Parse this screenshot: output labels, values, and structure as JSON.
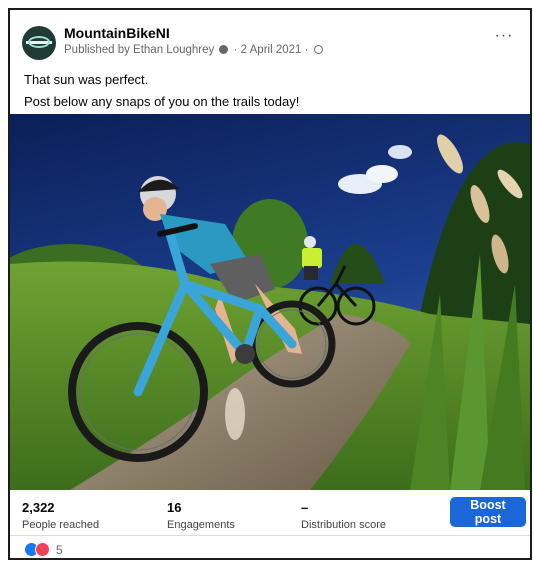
{
  "post": {
    "page_name": "MountainBikeNI",
    "published_by": "Published by Ethan Loughrey",
    "date": "· 2 April 2021 ·",
    "more_label": "···",
    "caption_line1": "That sun was perfect.",
    "caption_line2": "Post below any snaps of you on the trails today!"
  },
  "stats": {
    "people_reached_value": "2,322",
    "people_reached_label": "People reached",
    "engagements_value": "16",
    "engagements_label": "Engagements",
    "distribution_value": "–",
    "distribution_label": "Distribution score"
  },
  "boost_label": "Boost post",
  "reactions": {
    "count": "5",
    "icons": [
      "like-icon",
      "love-icon"
    ]
  },
  "colors": {
    "accent": "#1b66d9",
    "like": "#1877f2",
    "love": "#f33e58"
  }
}
